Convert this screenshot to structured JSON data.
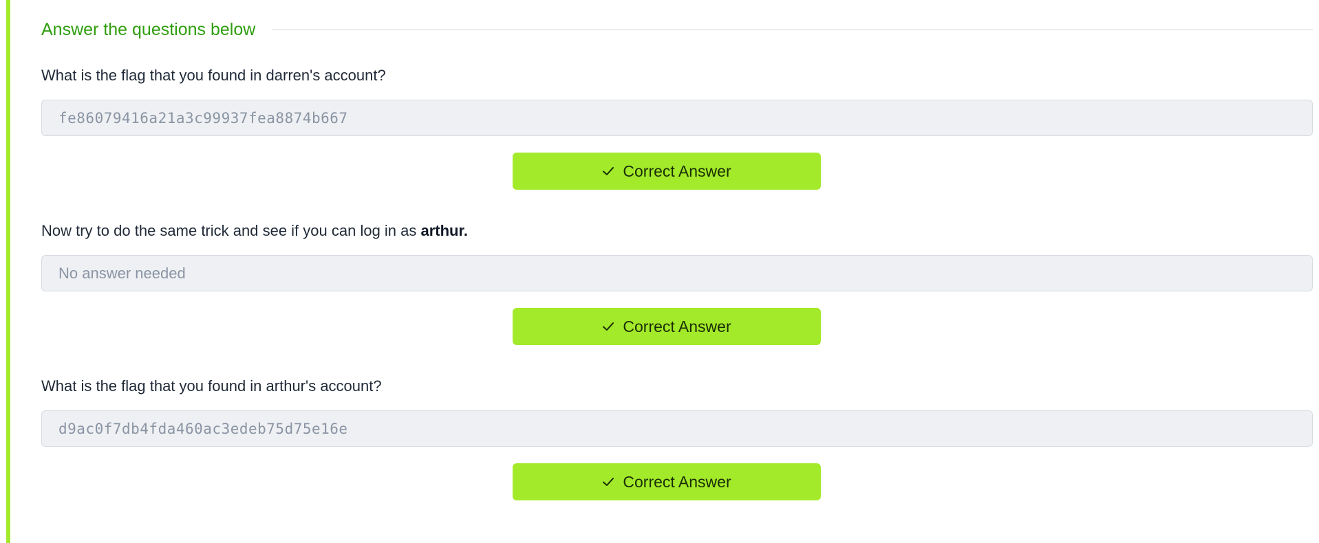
{
  "section": {
    "title": "Answer the questions below"
  },
  "questions": [
    {
      "text": "What is the flag that you found in darren's account?",
      "answer": "fe86079416a21a3c99937fea8874b667",
      "button_label": "Correct Answer"
    },
    {
      "text_prefix": "Now try to do the same trick and see if you can log in as ",
      "text_bold": "arthur.",
      "answer": "No answer needed",
      "button_label": "Correct Answer"
    },
    {
      "text": "What is the flag that you found in arthur's account?",
      "answer": "d9ac0f7db4fda460ac3edeb75d75e16e",
      "button_label": "Correct Answer"
    }
  ],
  "colors": {
    "accent": "#a3ea2a",
    "title": "#2f9e0f",
    "answer_bg": "#eef0f3"
  },
  "icons": {
    "button_icon": "check-icon"
  }
}
